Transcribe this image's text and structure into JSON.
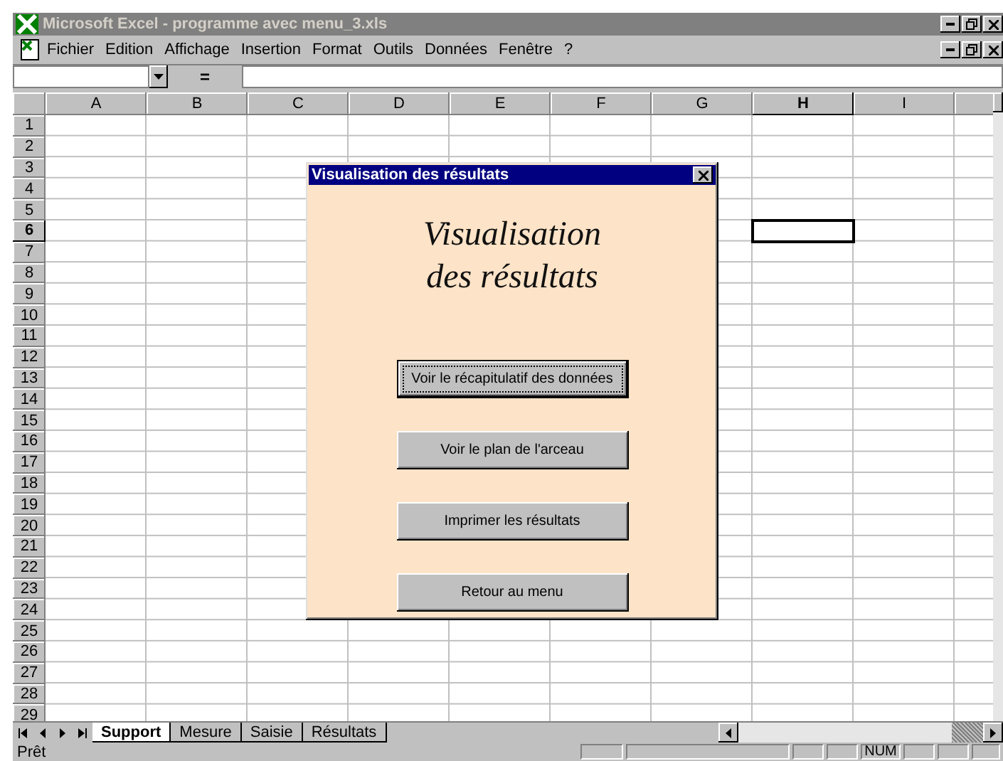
{
  "window": {
    "title": "Microsoft Excel - programme avec menu_3.xls"
  },
  "menu": [
    {
      "label": "Fichier"
    },
    {
      "label": "Edition"
    },
    {
      "label": "Affichage"
    },
    {
      "label": "Insertion"
    },
    {
      "label": "Format"
    },
    {
      "label": "Outils"
    },
    {
      "label": "Données"
    },
    {
      "label": "Fenêtre"
    },
    {
      "label": "?"
    }
  ],
  "formula_bar": {
    "equals": "="
  },
  "columns": [
    {
      "label": "A",
      "selected": false
    },
    {
      "label": "B",
      "selected": false
    },
    {
      "label": "C",
      "selected": false
    },
    {
      "label": "D",
      "selected": false
    },
    {
      "label": "E",
      "selected": false
    },
    {
      "label": "F",
      "selected": false
    },
    {
      "label": "G",
      "selected": false
    },
    {
      "label": "H",
      "selected": true
    },
    {
      "label": "I",
      "selected": false
    }
  ],
  "rows": [
    {
      "label": "1",
      "selected": false
    },
    {
      "label": "2",
      "selected": false
    },
    {
      "label": "3",
      "selected": false
    },
    {
      "label": "4",
      "selected": false
    },
    {
      "label": "5",
      "selected": false
    },
    {
      "label": "6",
      "selected": true
    },
    {
      "label": "7",
      "selected": false
    },
    {
      "label": "8",
      "selected": false
    },
    {
      "label": "9",
      "selected": false
    },
    {
      "label": "10",
      "selected": false
    },
    {
      "label": "11",
      "selected": false
    },
    {
      "label": "12",
      "selected": false
    },
    {
      "label": "13",
      "selected": false
    },
    {
      "label": "14",
      "selected": false
    },
    {
      "label": "15",
      "selected": false
    },
    {
      "label": "16",
      "selected": false
    },
    {
      "label": "17",
      "selected": false
    },
    {
      "label": "18",
      "selected": false
    },
    {
      "label": "19",
      "selected": false
    },
    {
      "label": "20",
      "selected": false
    },
    {
      "label": "21",
      "selected": false
    },
    {
      "label": "22",
      "selected": false
    },
    {
      "label": "23",
      "selected": false
    },
    {
      "label": "24",
      "selected": false
    },
    {
      "label": "25",
      "selected": false
    },
    {
      "label": "26",
      "selected": false
    },
    {
      "label": "27",
      "selected": false
    },
    {
      "label": "28",
      "selected": false
    },
    {
      "label": "29",
      "selected": false
    }
  ],
  "dialog": {
    "title": "Visualisation des résultats",
    "heading": [
      "Visualisation",
      "des résultats"
    ],
    "buttons": [
      {
        "label": "Voir le récapitulatif des données",
        "focused": true
      },
      {
        "label": "Voir le plan de l'arceau",
        "focused": false
      },
      {
        "label": "Imprimer les résultats",
        "focused": false
      },
      {
        "label": "Retour au menu",
        "focused": false
      }
    ]
  },
  "sheet_tabs": [
    {
      "label": "Support",
      "selected": true
    },
    {
      "label": "Mesure",
      "selected": false
    },
    {
      "label": "Saisie",
      "selected": false
    },
    {
      "label": "Résultats",
      "selected": false
    }
  ],
  "status_bar": {
    "text": "Prêt",
    "indicator": "NUM"
  }
}
